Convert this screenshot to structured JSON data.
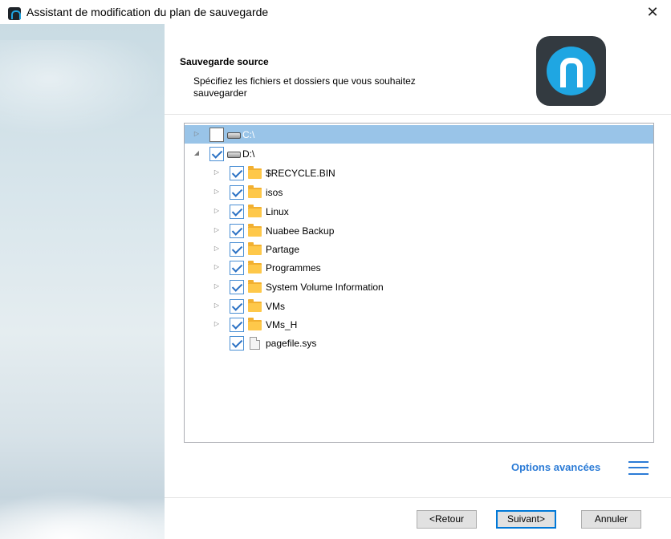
{
  "window": {
    "title": "Assistant de modification du plan de sauvegarde",
    "close_glyph": "✕"
  },
  "header": {
    "title": "Sauvegarde source",
    "subtitle": "Spécifiez les fichiers et dossiers que vous souhaitez sauvegarder",
    "logo": "brand-logo-icon"
  },
  "tree": {
    "items": [
      {
        "label": "C:\\",
        "checked": false,
        "expanded": false,
        "icon": "drive-icon",
        "selected": true
      },
      {
        "label": "D:\\",
        "checked": true,
        "expanded": true,
        "icon": "drive-icon",
        "selected": false
      },
      {
        "label": "$RECYCLE.BIN",
        "checked": true,
        "icon": "folder-icon"
      },
      {
        "label": "isos",
        "checked": true,
        "icon": "folder-icon"
      },
      {
        "label": "Linux",
        "checked": true,
        "icon": "folder-icon"
      },
      {
        "label": "Nuabee Backup",
        "checked": true,
        "icon": "folder-icon"
      },
      {
        "label": "Partage",
        "checked": true,
        "icon": "folder-icon"
      },
      {
        "label": "Programmes",
        "checked": true,
        "icon": "folder-icon"
      },
      {
        "label": "System Volume Information",
        "checked": true,
        "icon": "folder-icon"
      },
      {
        "label": "VMs",
        "checked": true,
        "icon": "folder-icon"
      },
      {
        "label": "VMs_H",
        "checked": true,
        "icon": "folder-icon"
      },
      {
        "label": "pagefile.sys",
        "checked": true,
        "icon": "file-icon"
      }
    ]
  },
  "options": {
    "advanced_label": "Options avancées",
    "menu_icon": "hamburger-menu-icon"
  },
  "buttons": {
    "back": "<Retour",
    "next": "Suivant>",
    "cancel": "Annuler"
  },
  "colors": {
    "accent": "#2b7bd6",
    "selection": "#99c4e8",
    "default_button_border": "#0078d7"
  }
}
